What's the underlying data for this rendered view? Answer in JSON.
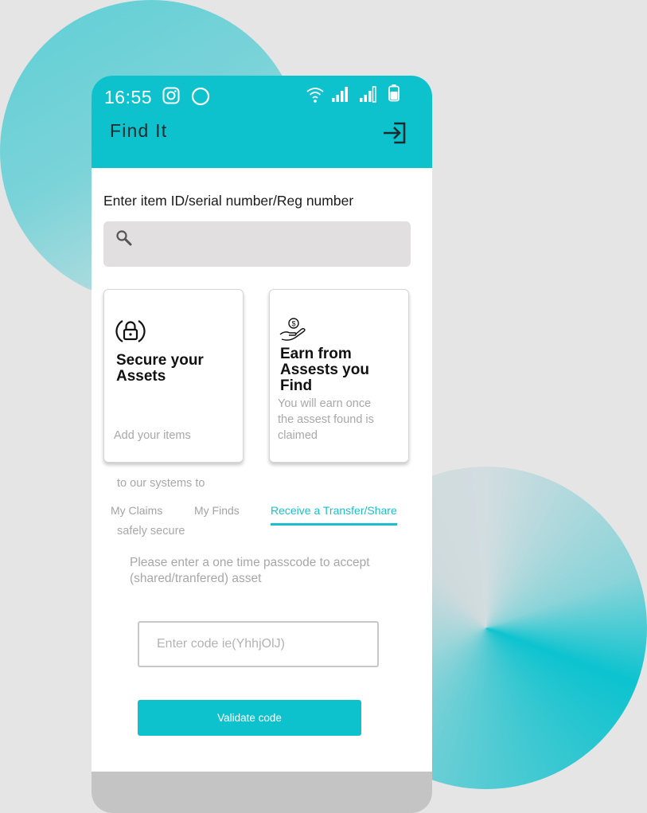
{
  "status_bar": {
    "time": "16:55",
    "icons": [
      "instagram-icon",
      "circle-icon",
      "wifi-icon",
      "signal-icon",
      "signal-icon",
      "battery-icon"
    ]
  },
  "header": {
    "title": "Find It",
    "login_icon": "login-icon"
  },
  "search": {
    "label": "Enter item ID/serial number/Reg number",
    "value": "",
    "icon": "search-icon"
  },
  "cards": [
    {
      "icon": "lock-icon",
      "title_lines": [
        "Secure your",
        "Assets"
      ],
      "desc_lines": [
        "Add your items",
        " to our systems to",
        " safely secure"
      ]
    },
    {
      "icon": "money-hand-icon",
      "title_lines": [
        "Earn from",
        "Assests you",
        "Find"
      ],
      "desc_lines": [
        "You will earn once",
        "the assest found is",
        "claimed"
      ]
    }
  ],
  "tabs": [
    {
      "label": "My Claims",
      "active": false
    },
    {
      "label": "My Finds",
      "active": false
    },
    {
      "label": "Receive a Transfer/Share",
      "active": true
    }
  ],
  "transfer": {
    "instruction_lines": [
      "Please enter a one time passcode to accept",
      "(shared/tranfered) asset"
    ],
    "code_placeholder": "Enter code ie(YhhjOlJ)",
    "code_value": "",
    "validate_label": "Validate code"
  },
  "colors": {
    "accent": "#0dc2cd",
    "active_tab": "#1abfcb",
    "background": "#e5e5e5",
    "search_bg": "#e1dfdf",
    "muted_text": "#a7a7a7",
    "bottom_bar": "#c4c4c4"
  }
}
